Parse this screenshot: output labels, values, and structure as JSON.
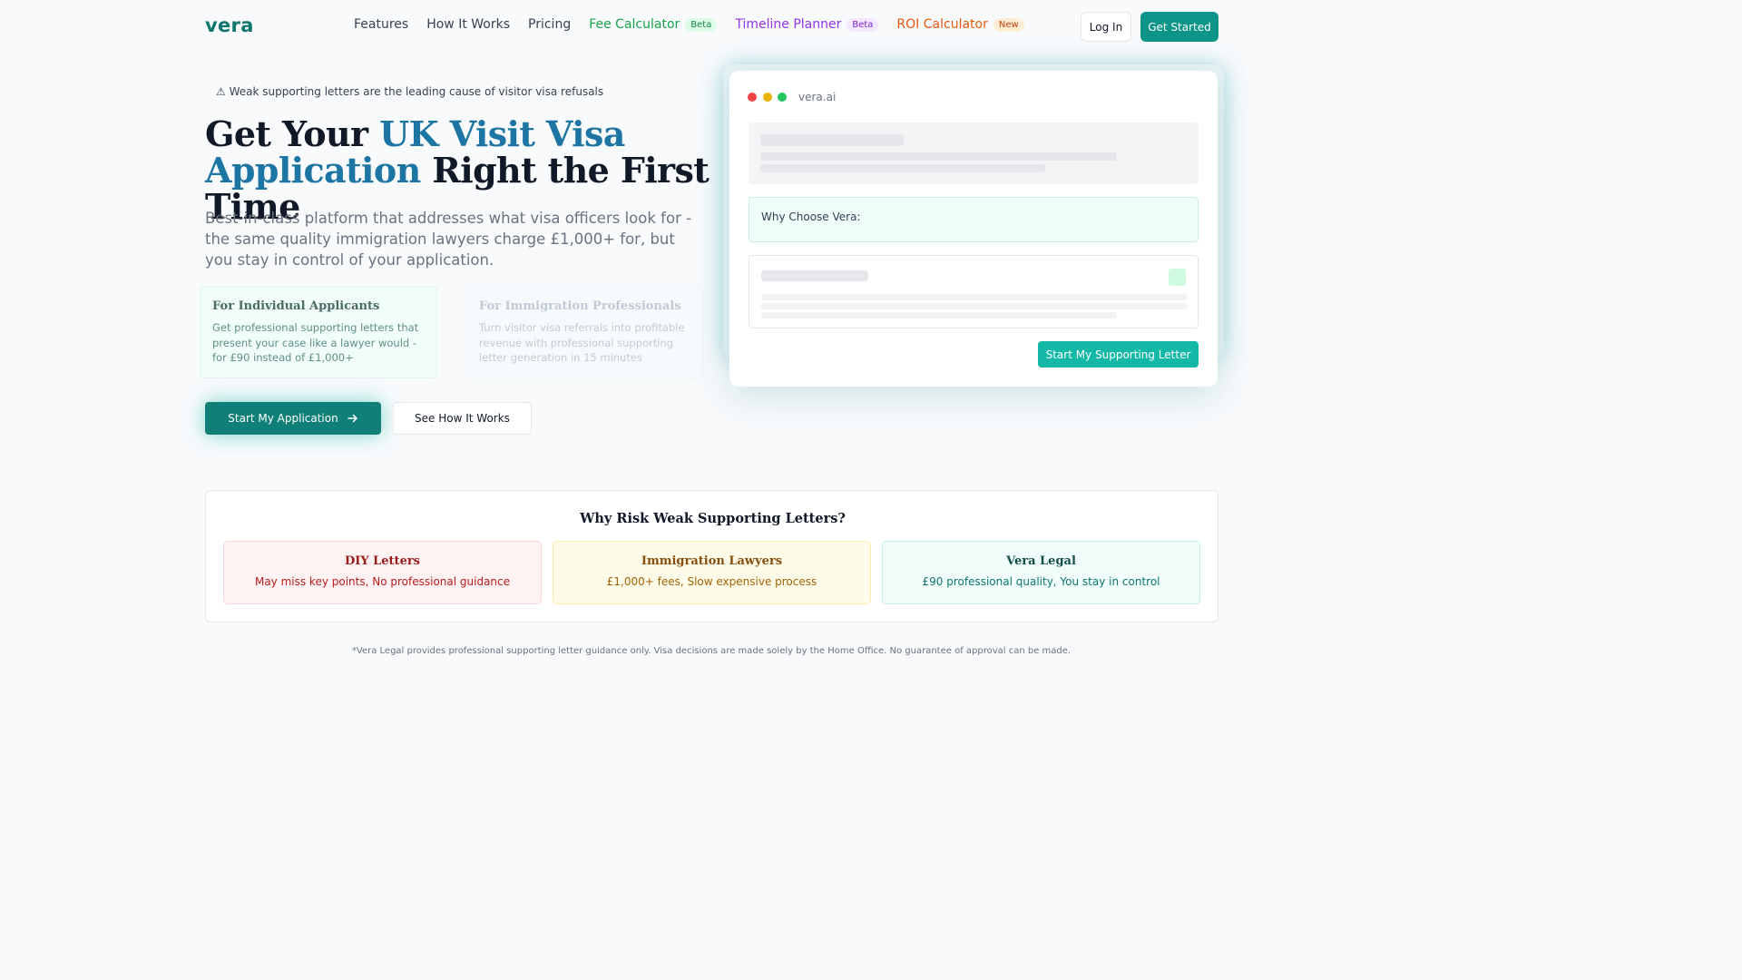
{
  "nav": {
    "logo": "vera",
    "links": [
      {
        "label": "Features"
      },
      {
        "label": "How It Works"
      },
      {
        "label": "Pricing"
      },
      {
        "label": "Fee Calculator",
        "badge": "Beta"
      },
      {
        "label": "Timeline Planner",
        "badge": "Beta"
      },
      {
        "label": "ROI Calculator",
        "badge": "New"
      }
    ],
    "login_label": "Log In",
    "get_started_label": "Get Started"
  },
  "hero": {
    "alert_icon": "warning-icon",
    "alert_glyph": "⚠",
    "alert_text": "Weak supporting letters are the leading cause of visitor visa refusals",
    "title_part1": "Get Your ",
    "title_highlight": "UK Visit Visa Application",
    "title_part2": " Right the First Time",
    "subtitle": "Best-in-class platform that addresses what visa officers look for - the same quality immigration lawyers charge £1,000+ for, but you stay in control of your application.",
    "cards": [
      {
        "title": "For Individual Applicants",
        "description": "Get professional supporting letters that present your case like a lawyer would - for £90 instead of £1,000+"
      },
      {
        "title": "For Immigration Professionals",
        "description": "Turn visitor visa referrals into profitable revenue with professional supporting letter generation in 15 minutes"
      }
    ],
    "primary_cta": "Start My Application",
    "primary_cta_icon": "arrow-right-icon",
    "secondary_cta": "See How It Works"
  },
  "mockup": {
    "url": "vera.ai",
    "why_label": "Why Choose Vera:",
    "cta": "Start My Supporting Letter"
  },
  "comparison": {
    "title": "Why Risk Weak Supporting Letters?",
    "options": [
      {
        "title": "DIY Letters",
        "description": "May miss key points, No professional guidance"
      },
      {
        "title": "Immigration Lawyers",
        "description": "£1,000+ fees, Slow expensive process"
      },
      {
        "title": "Vera Legal",
        "description": "£90 professional quality, You stay in control"
      }
    ]
  },
  "disclaimer": "*Vera Legal provides professional supporting letter guidance only. Visa decisions are made solely by the Home Office. No guarantee of approval can be made.",
  "colors": {
    "brand": "#0f766e",
    "accent_teal": "#14b8a6",
    "highlight_blue": "#1d75a3",
    "fee_green": "#16a34a",
    "timeline_purple": "#9333ea",
    "roi_orange": "#ea580c"
  }
}
